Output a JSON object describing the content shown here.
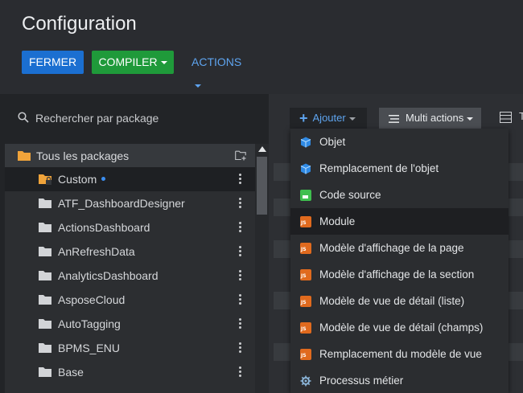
{
  "page": {
    "title": "Configuration"
  },
  "toolbar": {
    "close_label": "FERMER",
    "compile_label": "COMPILER",
    "actions_label": "ACTIONS"
  },
  "search": {
    "placeholder": "Rechercher par package"
  },
  "tree": {
    "root_label": "Tous les packages",
    "items": [
      {
        "label": "Custom",
        "locked": true,
        "modified": true,
        "selected": true
      },
      {
        "label": "ATF_DashboardDesigner"
      },
      {
        "label": "ActionsDashboard"
      },
      {
        "label": "AnRefreshData"
      },
      {
        "label": "AnalyticsDashboard"
      },
      {
        "label": "AsposeCloud"
      },
      {
        "label": "AutoTagging"
      },
      {
        "label": "BPMS_ENU"
      },
      {
        "label": "Base"
      }
    ]
  },
  "right_toolbar": {
    "add_label": "Ajouter",
    "multi_actions_label": "Multi actions",
    "tab_label": "T"
  },
  "add_menu": {
    "items": [
      {
        "label": "Objet",
        "icon": "cube-icon"
      },
      {
        "label": "Remplacement de l'objet",
        "icon": "cube-icon"
      },
      {
        "label": "Code source",
        "icon": "source-code-icon"
      },
      {
        "label": "Module",
        "icon": "js-file-icon",
        "highlighted": true
      },
      {
        "label": "Modèle d'affichage de la page",
        "icon": "js-file-icon"
      },
      {
        "label": "Modèle d'affichage de la section",
        "icon": "js-file-icon"
      },
      {
        "label": "Modèle de vue de détail (liste)",
        "icon": "js-file-icon"
      },
      {
        "label": "Modèle de vue de détail (champs)",
        "icon": "js-file-icon"
      },
      {
        "label": "Remplacement du modèle de vue",
        "icon": "js-file-icon"
      },
      {
        "label": "Processus métier",
        "icon": "process-gear-icon"
      }
    ]
  },
  "colors": {
    "primary_blue": "#1b6fd1",
    "compile_green": "#1f9a3a",
    "link_blue": "#5ea4ef",
    "folder_orange": "#f0a33a",
    "background": "#2a2c30"
  }
}
